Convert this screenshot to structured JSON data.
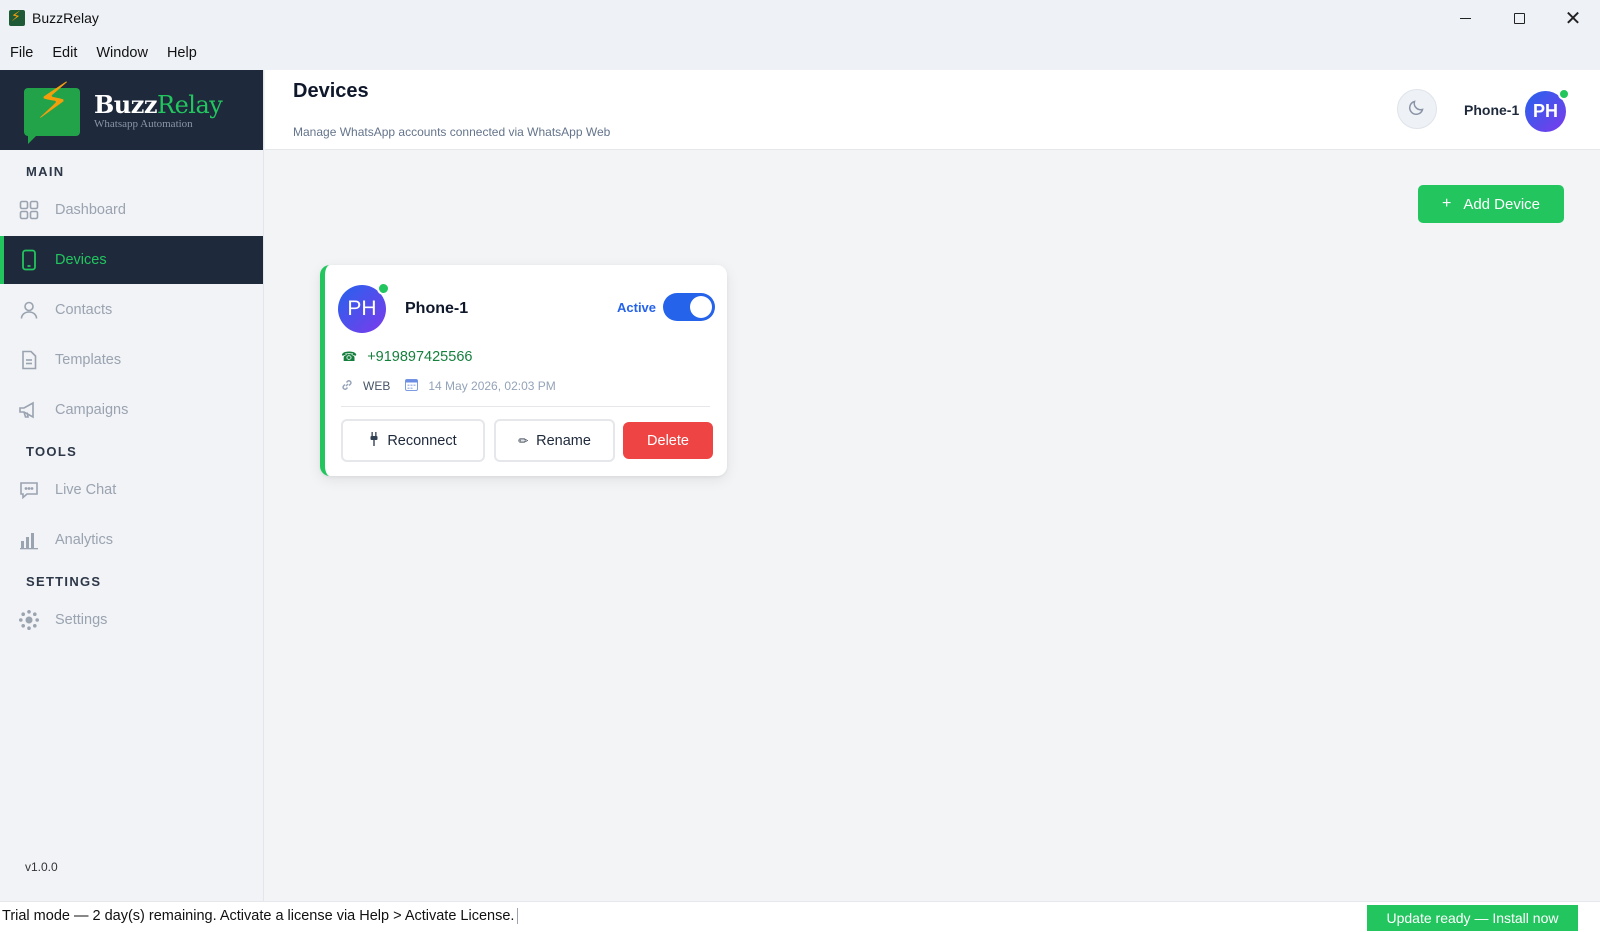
{
  "window": {
    "title": "BuzzRelay"
  },
  "menu": [
    "File",
    "Edit",
    "Window",
    "Help"
  ],
  "brand": {
    "name_part1": "Buzz",
    "name_part2": "Relay",
    "subtitle": "Whatsapp Automation"
  },
  "sidebar": {
    "sections": {
      "main": "MAIN",
      "tools": "TOOLS",
      "settings": "SETTINGS"
    },
    "items": [
      {
        "label": "Dashboard",
        "icon": "dashboard-icon",
        "active": false
      },
      {
        "label": "Devices",
        "icon": "phone-icon",
        "active": true
      },
      {
        "label": "Contacts",
        "icon": "user-icon",
        "active": false
      },
      {
        "label": "Templates",
        "icon": "document-icon",
        "active": false
      },
      {
        "label": "Campaigns",
        "icon": "megaphone-icon",
        "active": false
      },
      {
        "label": "Live Chat",
        "icon": "chat-icon",
        "active": false
      },
      {
        "label": "Analytics",
        "icon": "bar-chart-icon",
        "active": false
      },
      {
        "label": "Settings",
        "icon": "gear-icon",
        "active": false
      }
    ],
    "version": "v1.0.0"
  },
  "header": {
    "title": "Devices",
    "subtitle": "Manage WhatsApp accounts connected via WhatsApp Web",
    "user_name": "Phone-1",
    "user_initials": "PH"
  },
  "actions": {
    "add_device": "Add Device"
  },
  "device": {
    "initials": "PH",
    "name": "Phone-1",
    "status": "Active",
    "enabled": true,
    "phone": "+919897425566",
    "type": "WEB",
    "date": "14 May 2026, 02:03 PM",
    "buttons": {
      "reconnect": "Reconnect",
      "rename": "Rename",
      "delete": "Delete"
    }
  },
  "statusbar": {
    "trial_text": "Trial mode — 2 day(s) remaining. Activate a license via Help > Activate License.",
    "update_label": "Update ready — Install now"
  },
  "colors": {
    "accent": "#22c55e",
    "sidebar_dark": "#1e2a3b",
    "primary": "#2563eb",
    "danger": "#ef4444"
  }
}
